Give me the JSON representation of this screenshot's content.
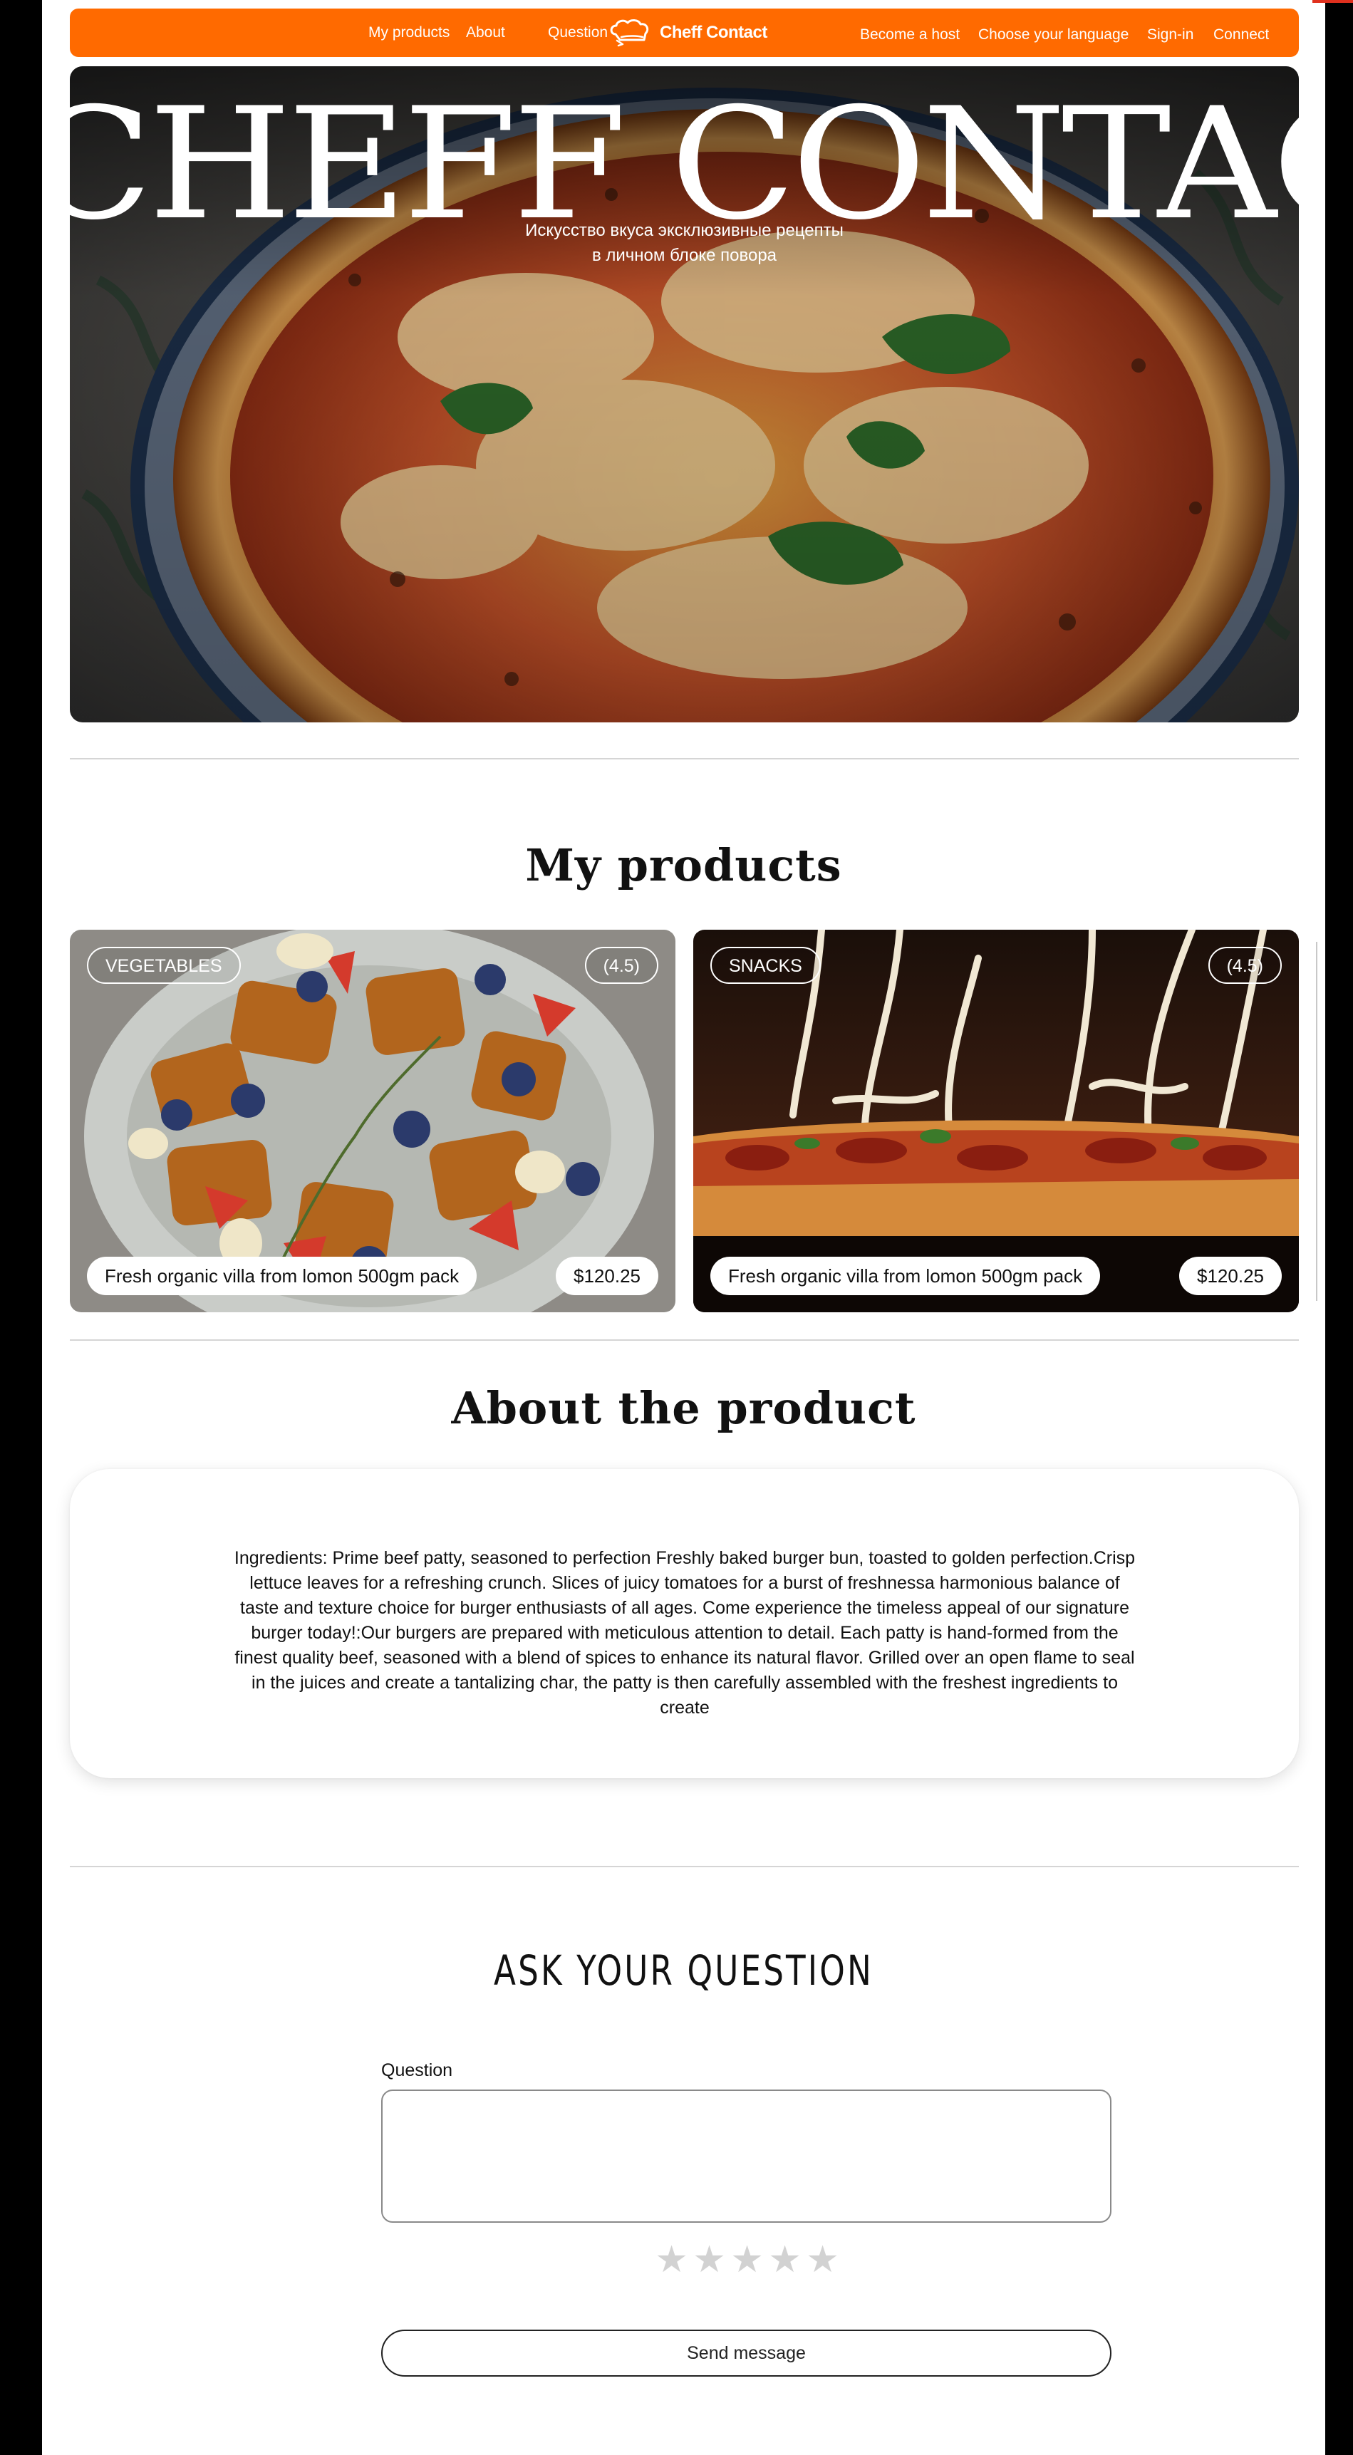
{
  "nav": {
    "links_left": [
      "My products",
      "About",
      "Question"
    ],
    "logo_text": "Cheff Contact",
    "logo_icon": "chef-hat-icon",
    "links_right": [
      "Become a host",
      "Choose your language",
      "Sign-in",
      "Connect"
    ]
  },
  "hero": {
    "title": "CHEFF CONTACT",
    "subtitle_line1": "Искусство вкуса эксклюзивные рецепты",
    "subtitle_line2": "в личном блоке повора"
  },
  "products": {
    "title": "My products",
    "items": [
      {
        "category": "VEGETABLES",
        "rating": "(4.5)",
        "name": "Fresh organic villa from lomon 500gm pack",
        "price": "$120.25"
      },
      {
        "category": "SNACKS",
        "rating": "(4.5)",
        "name": "Fresh organic villa from lomon 500gm pack",
        "price": "$120.25"
      }
    ]
  },
  "about": {
    "title": "About the product",
    "text": "Ingredients: Prime beef patty, seasoned to perfection  Freshly baked burger bun, toasted to golden perfection.Crisp lettuce leaves for a refreshing crunch. Slices of juicy tomatoes for a burst of freshnessa harmonious balance of taste and texture choice for burger enthusiasts of all ages. Come experience the timeless appeal of our signature burger today!:Our burgers are prepared with meticulous attention to detail. Each patty is hand-formed from the finest quality beef, seasoned with a blend of spices to enhance its natural flavor. Grilled over an open flame to seal in the juices and create a tantalizing char, the patty is then carefully assembled with the freshest ingredients to create"
  },
  "question": {
    "title": "ASK YOUR QUESTION",
    "label": "Question",
    "value": "",
    "stars": [
      "★",
      "★",
      "★",
      "★",
      "★"
    ],
    "rating_selected": 0,
    "send_label": "Send message"
  },
  "colors": {
    "accent": "#ff6a00",
    "star_inactive": "#d2d2d2",
    "page_bg": "#ffffff",
    "outer_bg": "#000000"
  }
}
